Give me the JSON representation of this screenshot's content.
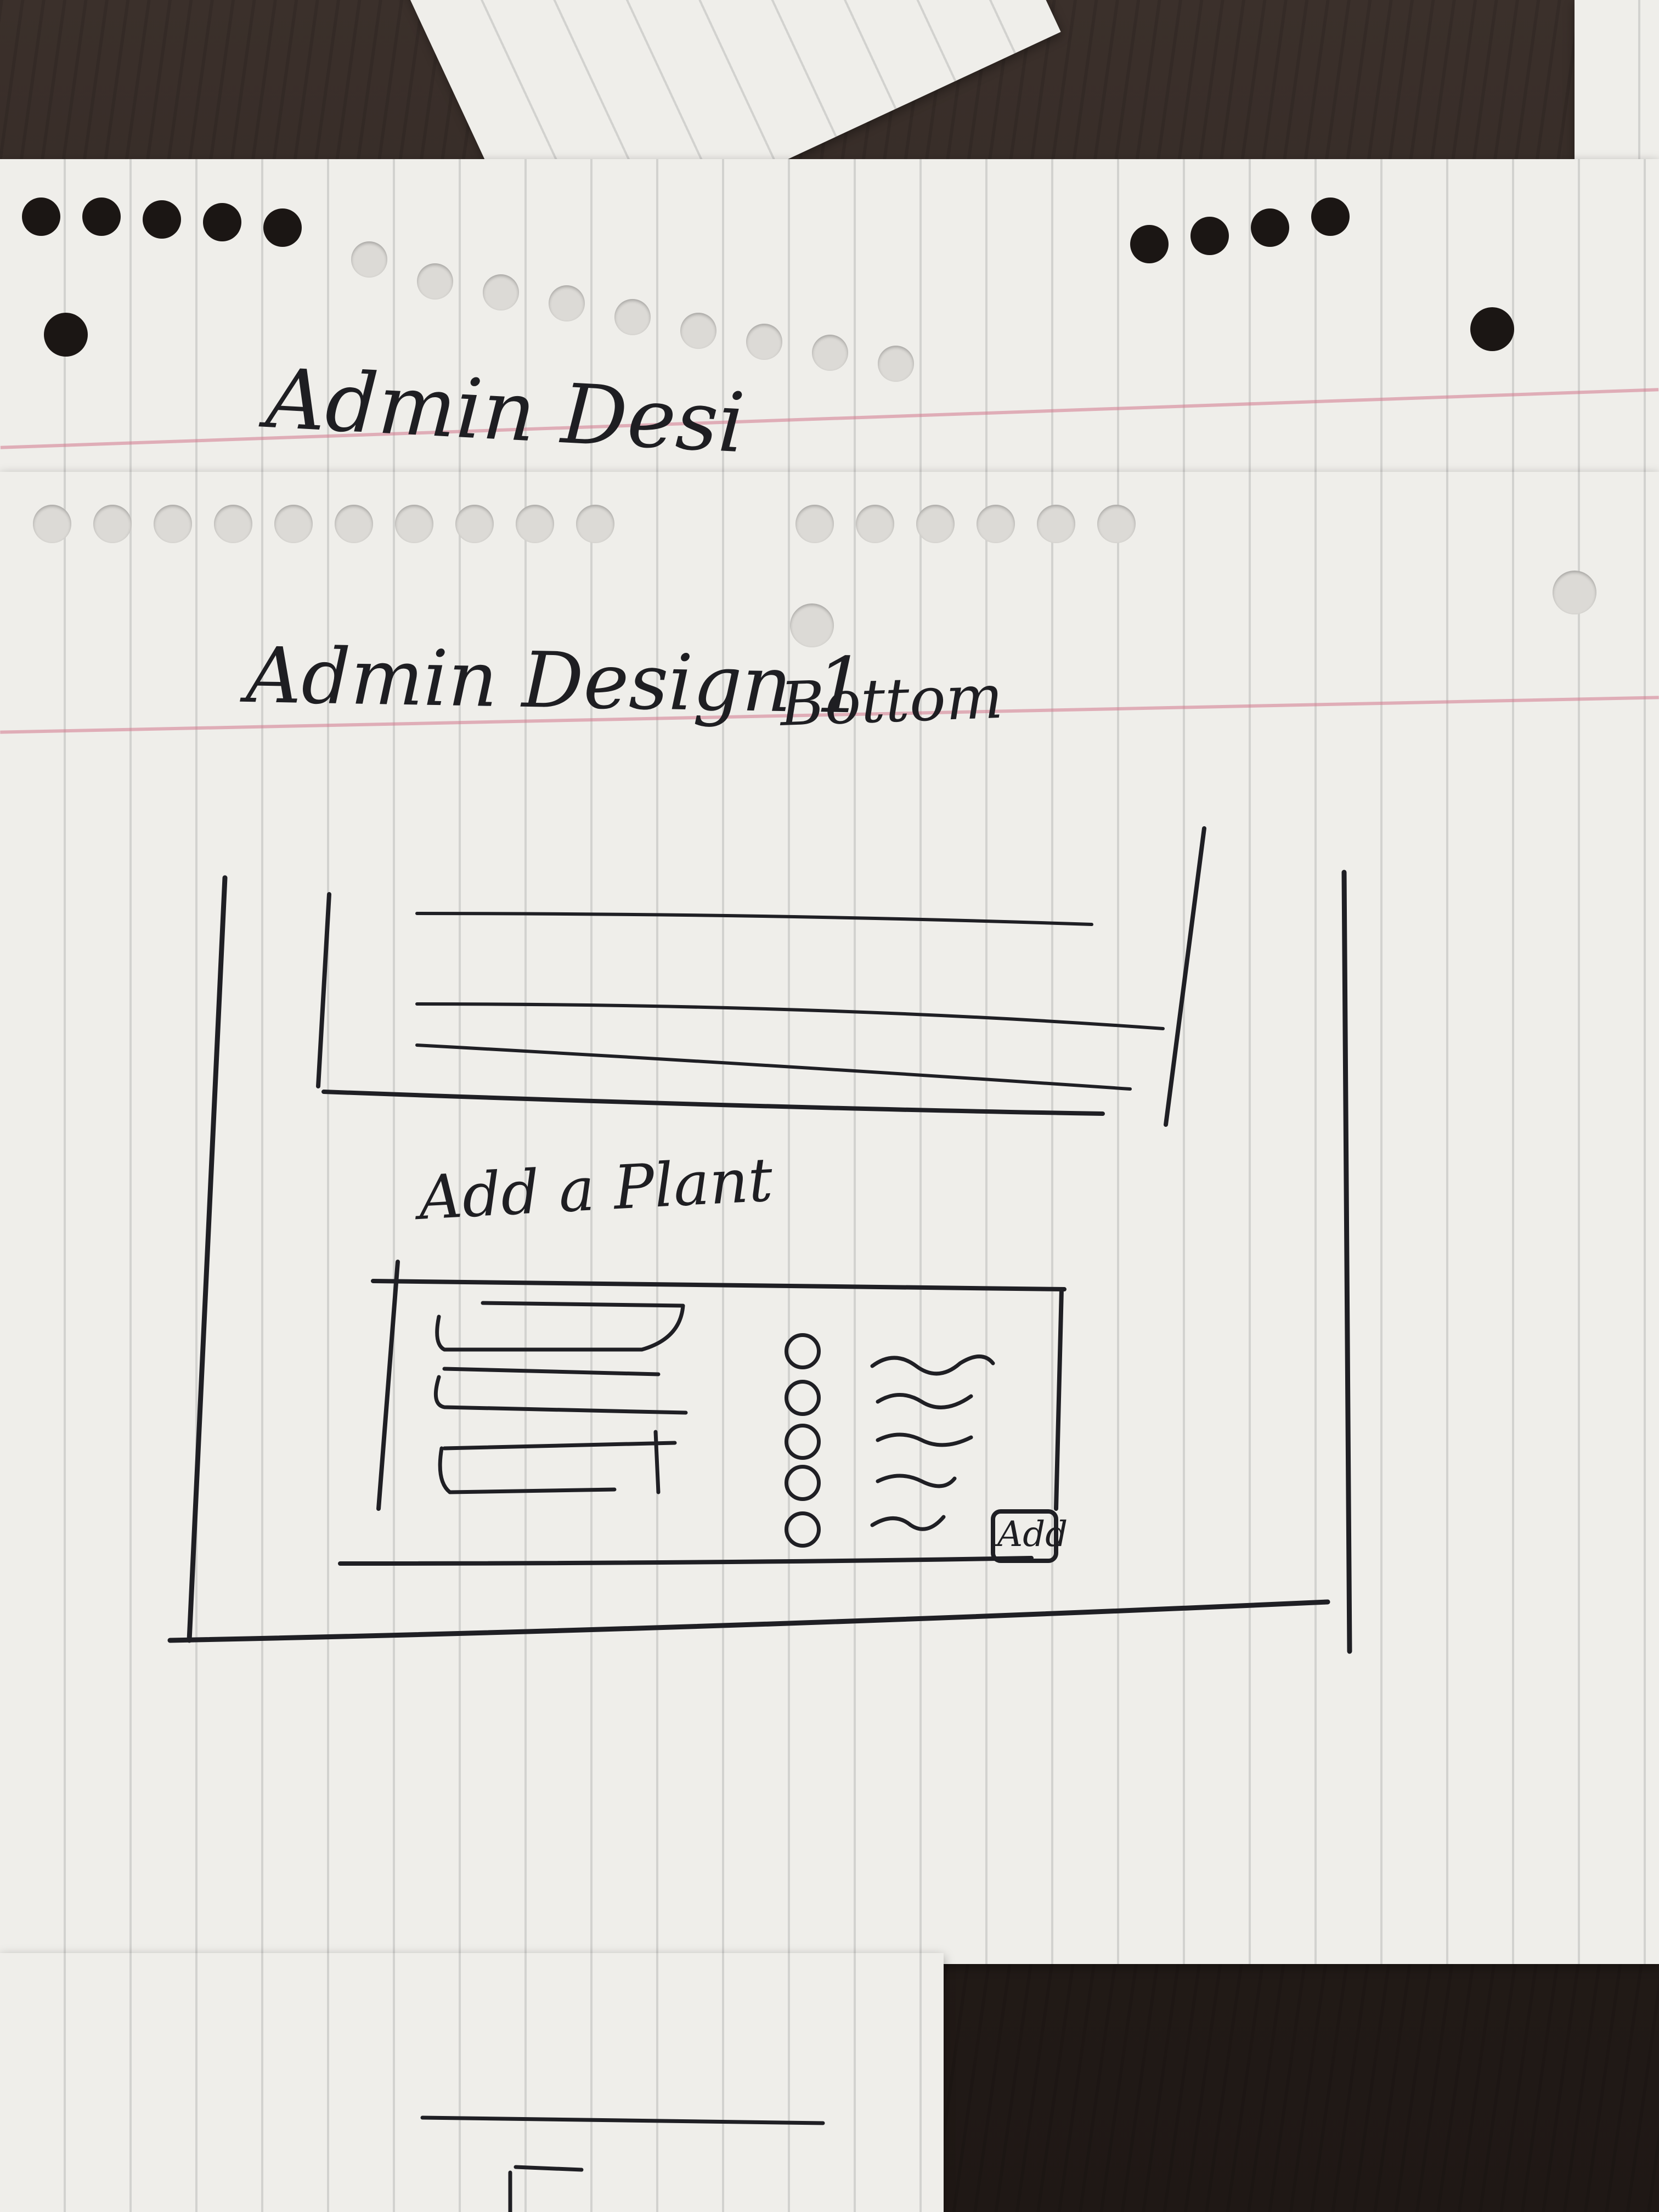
{
  "page_notes": [
    {
      "id": "back",
      "text": "Admin Desi"
    },
    {
      "id": "front",
      "text": "Admin Design 1"
    }
  ],
  "front_note_suffix": "Bottom",
  "sketch": {
    "section_label": "Add a Plant",
    "add_button_label": "Add",
    "radio_option_count": 5
  },
  "colors": {
    "paper": "#efeeea",
    "ink": "#1f1f24",
    "margin_line": "#d2788c",
    "table": "#2e2521"
  }
}
